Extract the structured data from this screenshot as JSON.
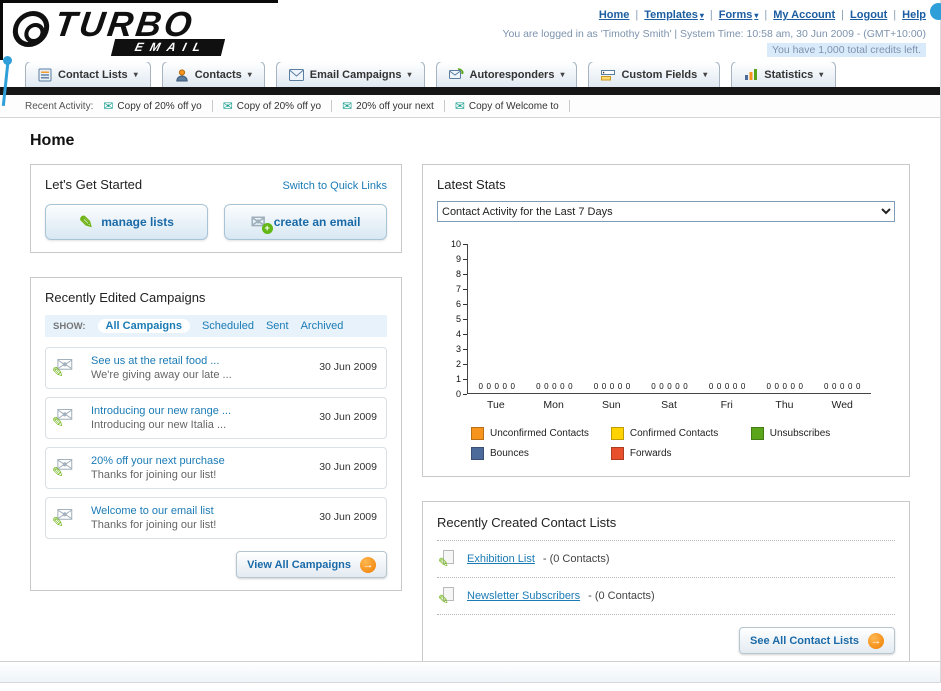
{
  "icons": {
    "caret": "▾",
    "envelope": "✉",
    "pencil": "✎",
    "arrow": "→",
    "plus": "+"
  },
  "header": {
    "logo_main": "TURBO",
    "logo_sub": "EMAIL",
    "links": [
      "Home",
      "Templates",
      "Forms",
      "My Account",
      "Logout",
      "Help"
    ],
    "status_line": "You are logged in as 'Timothy Smith' | System Time: 10:58 am, 30 Jun 2009 - (GMT+10:00)",
    "credits_line": "You have 1,000 total credits left."
  },
  "nav": {
    "items": [
      {
        "label": "Contact Lists"
      },
      {
        "label": "Contacts"
      },
      {
        "label": "Email Campaigns"
      },
      {
        "label": "Autoresponders"
      },
      {
        "label": "Custom Fields"
      },
      {
        "label": "Statistics"
      }
    ]
  },
  "recent_activity": {
    "label": "Recent Activity:",
    "items": [
      "Copy of 20% off yo",
      "Copy of 20% off yo",
      "20% off your next",
      "Copy of Welcome to"
    ]
  },
  "page_title": "Home",
  "get_started": {
    "title": "Let's Get Started",
    "switch_link": "Switch to Quick Links",
    "manage_lists_label": "manage lists",
    "create_email_label": "create an email"
  },
  "campaigns": {
    "title": "Recently Edited Campaigns",
    "show_label": "SHOW:",
    "tabs": [
      "All Campaigns",
      "Scheduled",
      "Sent",
      "Archived"
    ],
    "items": [
      {
        "title": "See us at the retail food ...",
        "subtitle": "We're giving away our late ...",
        "date": "30 Jun 2009"
      },
      {
        "title": "Introducing our new range ...",
        "subtitle": "Introducing our new Italia ...",
        "date": "30 Jun 2009"
      },
      {
        "title": "20% off your next purchase",
        "subtitle": "Thanks for joining our list!",
        "date": "30 Jun 2009"
      },
      {
        "title": "Welcome to our email list",
        "subtitle": "Thanks for joining our list!",
        "date": "30 Jun 2009"
      }
    ],
    "view_all_label": "View All Campaigns"
  },
  "stats": {
    "title": "Latest Stats",
    "dropdown_value": "Contact Activity for the Last 7 Days"
  },
  "chart_data": {
    "type": "bar",
    "title": "Contact Activity for the Last 7 Days",
    "categories": [
      "Tue",
      "Mon",
      "Sun",
      "Sat",
      "Fri",
      "Thu",
      "Wed"
    ],
    "series": [
      {
        "name": "Unconfirmed Contacts",
        "color": "#F7941D",
        "values": [
          0,
          0,
          0,
          0,
          0,
          0,
          0
        ]
      },
      {
        "name": "Confirmed Contacts",
        "color": "#FFD200",
        "values": [
          0,
          0,
          0,
          0,
          0,
          0,
          0
        ]
      },
      {
        "name": "Unsubscribes",
        "color": "#5BA51B",
        "values": [
          0,
          0,
          0,
          0,
          0,
          0,
          0
        ]
      },
      {
        "name": "Bounces",
        "color": "#4C6B9A",
        "values": [
          0,
          0,
          0,
          0,
          0,
          0,
          0
        ]
      },
      {
        "name": "Forwards",
        "color": "#E8502D",
        "values": [
          0,
          0,
          0,
          0,
          0,
          0,
          0
        ]
      }
    ],
    "ylim": [
      0,
      10
    ],
    "ytick_step": 1,
    "grid": false,
    "legend_position": "bottom"
  },
  "contact_lists": {
    "title": "Recently Created Contact Lists",
    "items": [
      {
        "name": "Exhibition List",
        "suffix": "- (0 Contacts)"
      },
      {
        "name": "Newsletter Subscribers",
        "suffix": "- (0 Contacts)"
      }
    ],
    "see_all_label": "See All Contact Lists"
  }
}
